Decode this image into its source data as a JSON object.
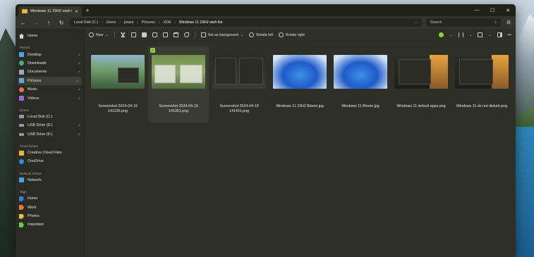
{
  "window": {
    "tab_title": "Windows 11 23H2 wish list",
    "tab_close": "✕",
    "new_tab": "+",
    "min": "—",
    "max": "☐",
    "close": "✕"
  },
  "address": {
    "back": "←",
    "forward": "→",
    "up": "↑",
    "refresh": "↻",
    "crumbs": [
      "Local Disk (C:)",
      "Users",
      "jowes",
      "Pictures",
      "XDA",
      "Windows 11 23H2 wish list"
    ],
    "sep": "›",
    "dropdown": "⌄",
    "search_placeholder": "Search",
    "search_icon": "⌕",
    "settings_icon": "⚙"
  },
  "toolbar": {
    "new_label": "New",
    "set_background": "Set as background",
    "rotate_left": "Rotate left",
    "rotate_right": "Rotate right",
    "more": "•••"
  },
  "sidebar": {
    "home": "Home",
    "pinned_label": "Pinned",
    "pinned": [
      "Desktop",
      "Downloads",
      "Documents",
      "Pictures",
      "Music",
      "Videos"
    ],
    "drives_label": "Drives",
    "drives": [
      "Local Disk (C:)",
      "USB Drive (D:)",
      "USB Drive (E:)"
    ],
    "cloud_label": "Cloud Drives",
    "cloud": [
      "Creative Cloud Files",
      "OneDrive"
    ],
    "network_label": "Network Drives",
    "network": [
      "Network"
    ],
    "tags_label": "Tags",
    "tags": [
      "Home",
      "Work",
      "Photos",
      "Important"
    ],
    "pin_glyph": "⊿"
  },
  "files": [
    {
      "name": "Screenshot 2024-04-19 141236.png"
    },
    {
      "name": "Screenshot 2024-04-19 141351.png"
    },
    {
      "name": "Screenshot 2024-04-19 141431.png"
    },
    {
      "name": "Windows 11 23H2 Bloom.jpg"
    },
    {
      "name": "Windows 11 Bloom.jpg"
    },
    {
      "name": "Windows 11 default apps.png"
    },
    {
      "name": "Windows 11 do not disturb.png"
    }
  ],
  "selected_check": "✓",
  "colors": {
    "accent": "#8fcf3a",
    "folder": "#e8b43b"
  }
}
